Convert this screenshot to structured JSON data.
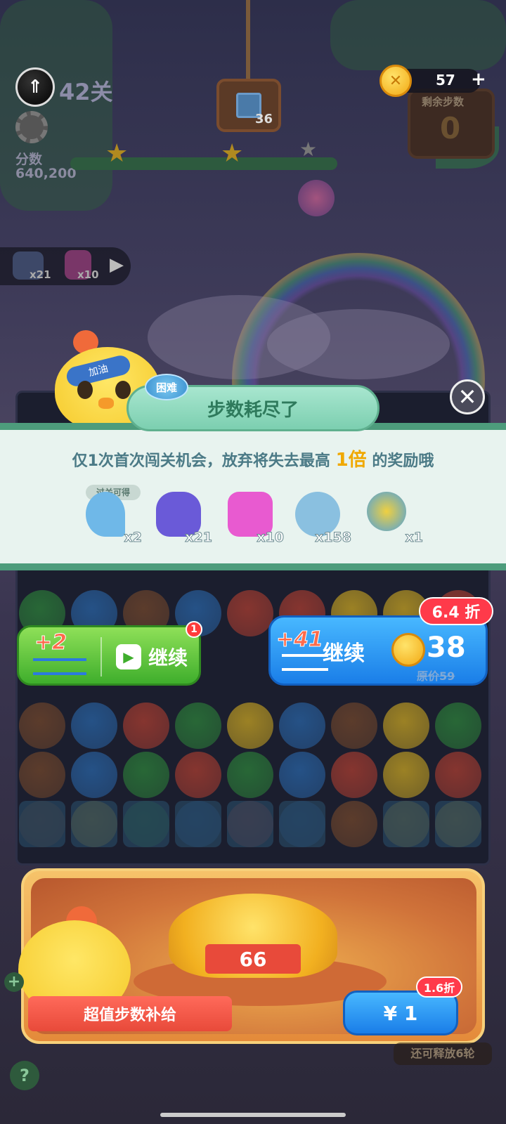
{
  "hud": {
    "level": "42关",
    "score_label": "分数",
    "score_value": "640,200",
    "target_count": "36",
    "coins": "57",
    "coins_plus": "+",
    "moves_label": "剩余步数",
    "moves_value": "0"
  },
  "tools": [
    {
      "icon": "bag-icon",
      "count": "x21"
    },
    {
      "icon": "lightning-icon",
      "count": "x10"
    }
  ],
  "popup": {
    "difficulty_tag": "困难",
    "title": "步数耗尽了",
    "message_prefix": "仅1次首次闯关机会，放弃将失去最高 ",
    "message_highlight": "1倍",
    "message_suffix": " 的奖励哦",
    "reward_tag": "过关可得",
    "rewards": [
      {
        "icon": "hook-icon",
        "count": "x2"
      },
      {
        "icon": "bag-icon",
        "count": "x21"
      },
      {
        "icon": "lightning-icon",
        "count": "x10"
      },
      {
        "icon": "magnifier-pouch-icon",
        "count": "x158"
      },
      {
        "icon": "color-bomb-icon",
        "count": "x1"
      }
    ]
  },
  "continue_free": {
    "plus_moves": "+2",
    "label": "继续",
    "badge": "1"
  },
  "continue_paid": {
    "plus_moves": "+41",
    "label": "继续",
    "price": "38",
    "original_price": "原价59",
    "discount": "6.4 折"
  },
  "offer": {
    "amount": "66",
    "label": "超值步数补给",
    "price": "¥ 1",
    "discount": "1.6折",
    "release_text": "还可释放6轮"
  },
  "colors": {
    "accent_green": "#3fae2c",
    "accent_blue": "#1a7ee8",
    "discount_red": "#ff3a4a",
    "panel_bg": "#e8f3ef",
    "highlight": "#f0a800"
  }
}
